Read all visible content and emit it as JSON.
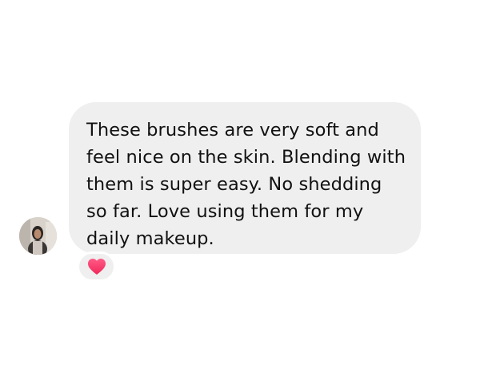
{
  "message": {
    "text": "These brushes are very soft and feel nice on the skin. Blending with them is super easy. No shedding so far. Love using them for my daily makeup."
  },
  "sender": {
    "avatar_icon": "profile-photo"
  },
  "reaction": {
    "icon": "heart-icon",
    "color": "#ff3b6b"
  },
  "colors": {
    "bubble": "#efefef",
    "text": "#111111",
    "background": "#ffffff"
  }
}
